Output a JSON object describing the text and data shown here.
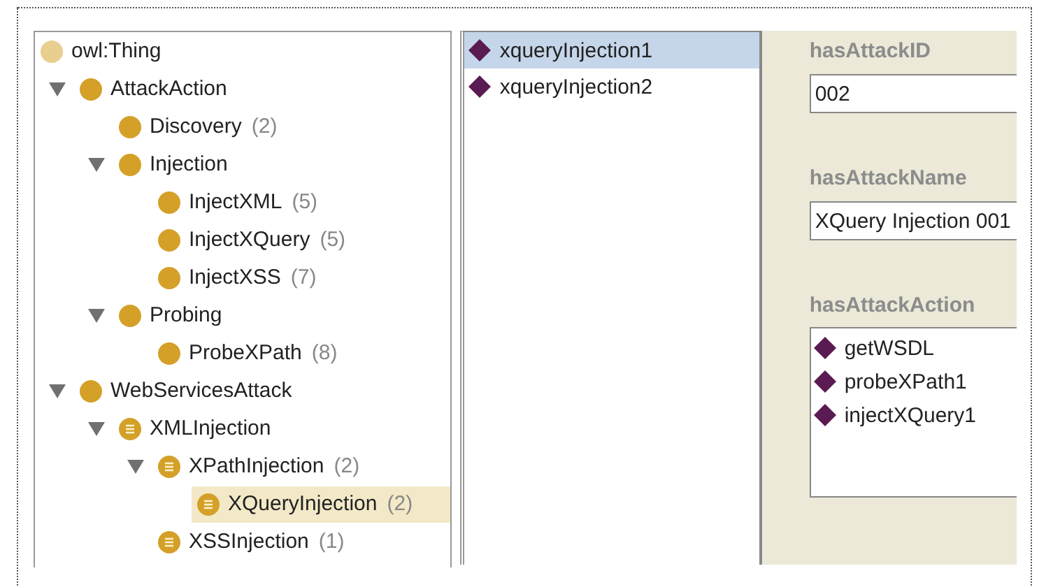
{
  "class_tree": [
    {
      "label": "owl:Thing",
      "kind": "thing",
      "selected": false,
      "children": [
        {
          "label": "AttackAction",
          "kind": "class",
          "selected": false,
          "expanded": true,
          "children": [
            {
              "label": "Discovery",
              "count": "(2)",
              "kind": "class",
              "selected": false
            },
            {
              "label": "Injection",
              "kind": "class",
              "selected": false,
              "expanded": true,
              "children": [
                {
                  "label": "InjectXML",
                  "count": "(5)",
                  "kind": "class",
                  "selected": false
                },
                {
                  "label": "InjectXQuery",
                  "count": "(5)",
                  "kind": "class",
                  "selected": false
                },
                {
                  "label": "InjectXSS",
                  "count": "(7)",
                  "kind": "class",
                  "selected": false
                }
              ]
            },
            {
              "label": "Probing",
              "kind": "class",
              "selected": false,
              "expanded": true,
              "children": [
                {
                  "label": "ProbeXPath",
                  "count": "(8)",
                  "kind": "class",
                  "selected": false
                }
              ]
            }
          ]
        },
        {
          "label": "WebServicesAttack",
          "kind": "class",
          "selected": false,
          "expanded": true,
          "children": [
            {
              "label": "XMLInjection",
              "kind": "defined",
              "selected": false,
              "expanded": true,
              "children": [
                {
                  "label": "XPathInjection",
                  "count": "(2)",
                  "kind": "defined",
                  "selected": false,
                  "expanded": true,
                  "children": [
                    {
                      "label": "XQueryInjection",
                      "count": "(2)",
                      "kind": "defined",
                      "selected": true
                    }
                  ]
                },
                {
                  "label": "XSSInjection",
                  "count": "(1)",
                  "kind": "defined",
                  "selected": false
                }
              ]
            }
          ]
        }
      ]
    }
  ],
  "instances": [
    {
      "label": "xqueryInjection1",
      "selected": true
    },
    {
      "label": "xqueryInjection2",
      "selected": false
    }
  ],
  "properties": [
    {
      "name": "hasAttackID",
      "kind": "text",
      "value": "002"
    },
    {
      "name": "hasAttackName",
      "kind": "text",
      "value": "XQuery Injection 001"
    },
    {
      "name": "hasAttackAction",
      "kind": "list",
      "values": [
        "getWSDL",
        "probeXPath1",
        "injectXQuery1"
      ]
    }
  ]
}
